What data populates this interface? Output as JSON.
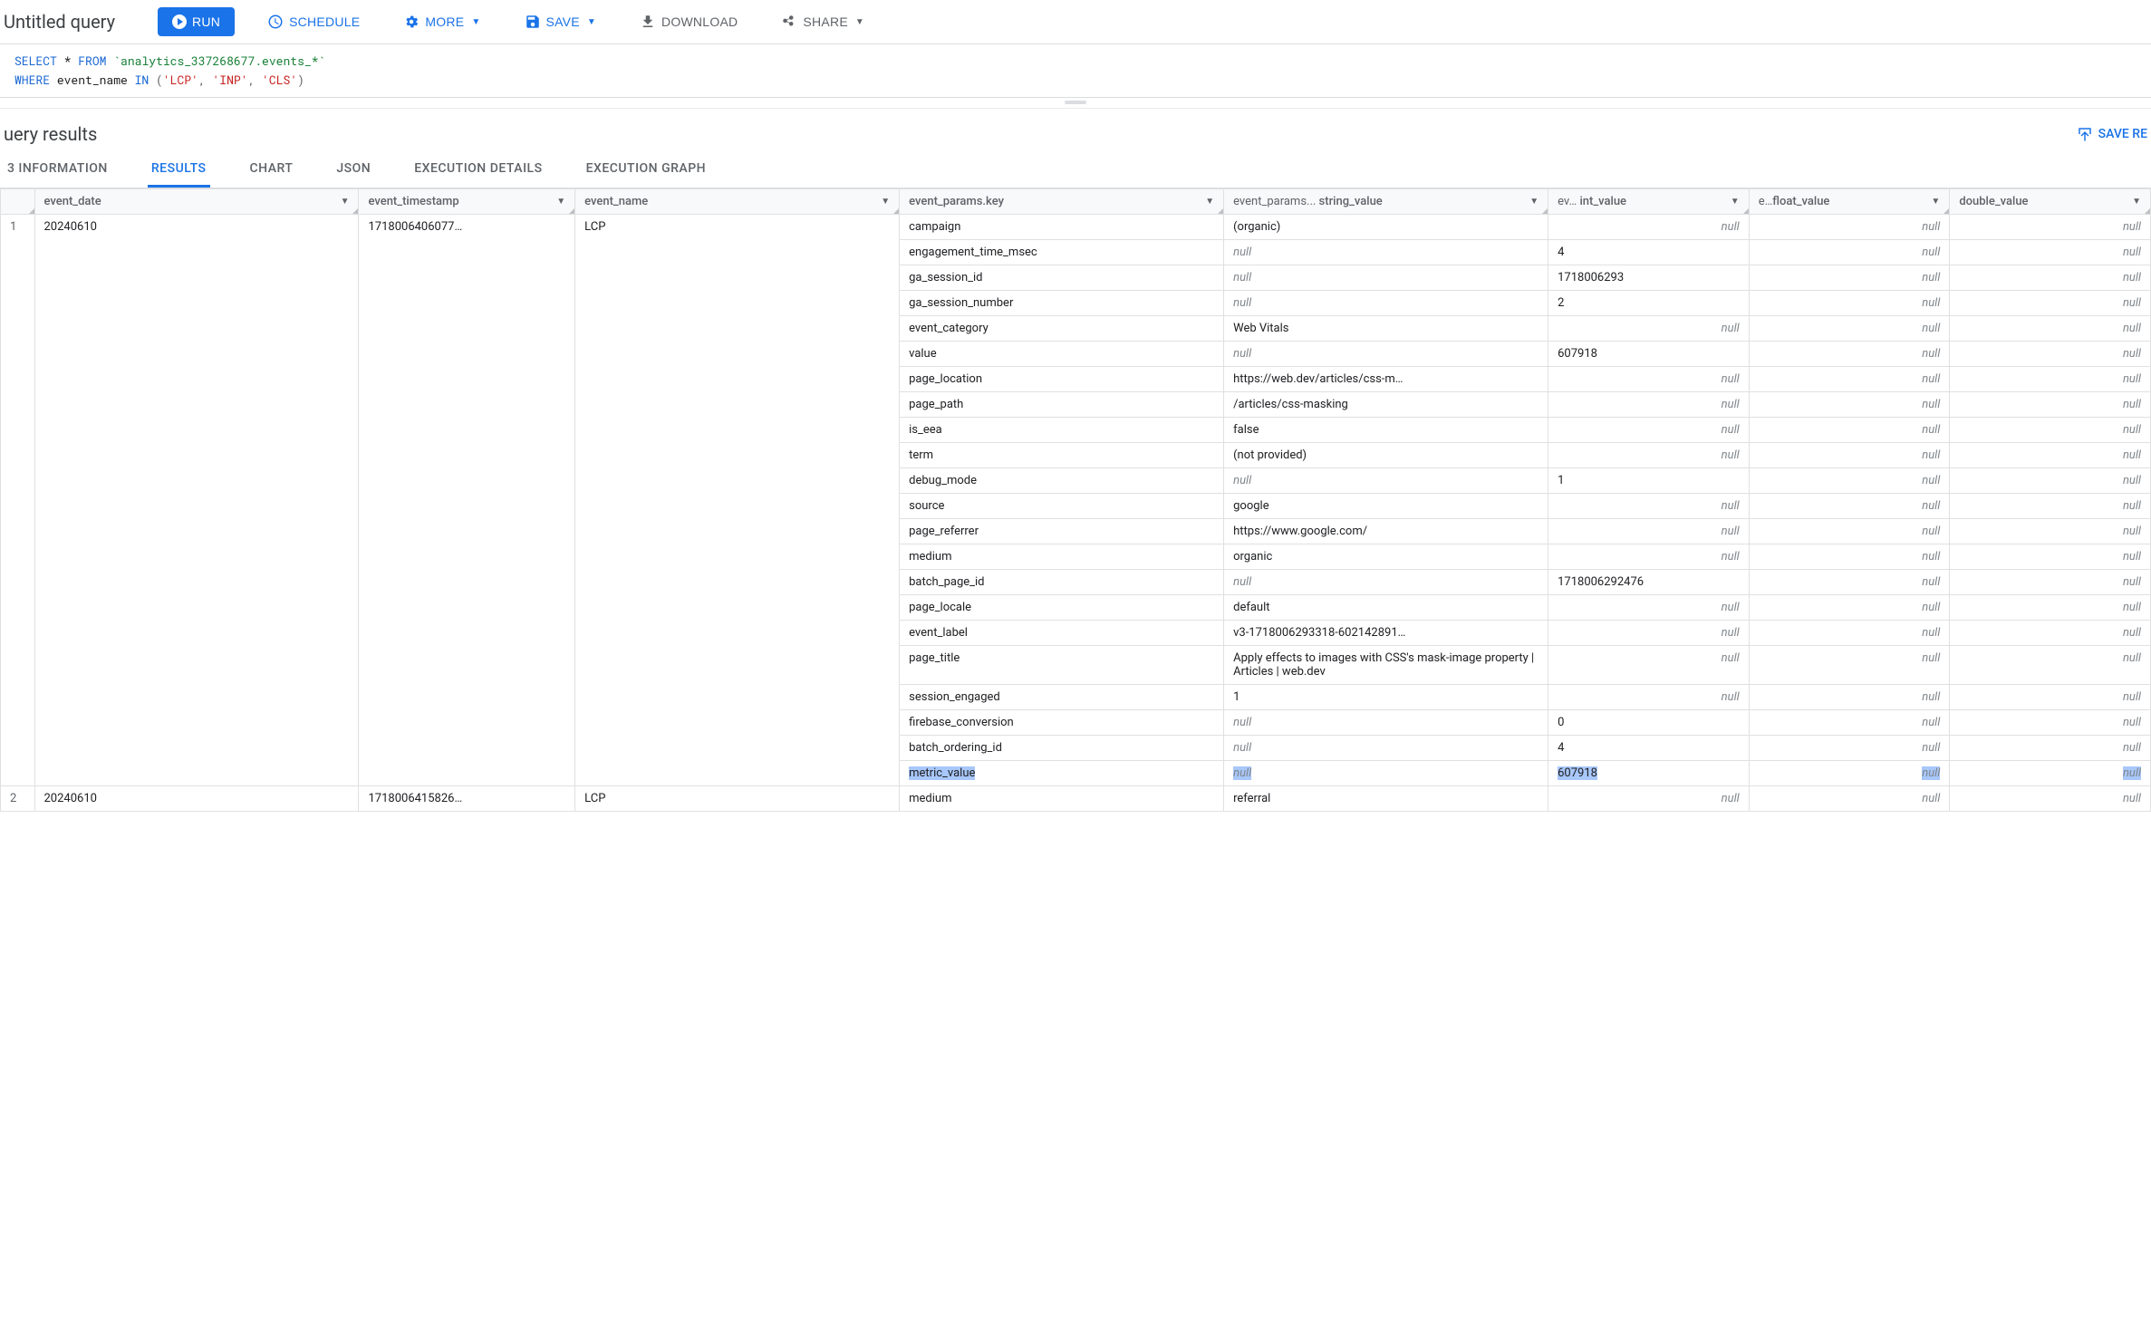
{
  "toolbar": {
    "title": "Untitled query",
    "run": "RUN",
    "schedule": "SCHEDULE",
    "more": "MORE",
    "save": "SAVE",
    "download": "DOWNLOAD",
    "share": "SHARE"
  },
  "sql": {
    "l1_kw1": "SELECT ",
    "l1_star": "*",
    "l1_kw2": " FROM ",
    "l1_tbl": "`analytics_337268677.events_*`",
    "l2_kw1": "WHERE ",
    "l2_field": "event_name",
    "l2_kw2": " IN ",
    "l2_open": "(",
    "l2_s1": "'LCP'",
    "l2_c1": ", ",
    "l2_s2": "'INP'",
    "l2_c2": ", ",
    "l2_s3": "'CLS'",
    "l2_close": ")"
  },
  "results": {
    "title": "uery results",
    "save_results": "SAVE RE"
  },
  "tabs": [
    "3 INFORMATION",
    "RESULTS",
    "CHART",
    "JSON",
    "EXECUTION DETAILS",
    "EXECUTION GRAPH"
  ],
  "headers": {
    "row": "",
    "event_date": "event_date",
    "event_timestamp": "event_timestamp",
    "event_name": "event_name",
    "key": "event_params.key",
    "string_value": "string_value",
    "string_value_prefix": "event_params...",
    "int_value": "int_value",
    "int_value_prefix": "ev…",
    "float_value": "float_value",
    "float_value_prefix": "e…",
    "double_value": "double_value"
  },
  "rows": [
    {
      "row": "1",
      "event_date": "20240610",
      "event_timestamp": "1718006406077…",
      "event_name": "LCP",
      "params": [
        {
          "key": "campaign",
          "sv": "(organic)",
          "iv": null,
          "fv": null,
          "dv": null
        },
        {
          "key": "engagement_time_msec",
          "sv": null,
          "iv": "4",
          "fv": null,
          "dv": null
        },
        {
          "key": "ga_session_id",
          "sv": null,
          "iv": "1718006293",
          "fv": null,
          "dv": null
        },
        {
          "key": "ga_session_number",
          "sv": null,
          "iv": "2",
          "fv": null,
          "dv": null
        },
        {
          "key": "event_category",
          "sv": "Web Vitals",
          "iv": null,
          "fv": null,
          "dv": null
        },
        {
          "key": "value",
          "sv": null,
          "iv": "607918",
          "fv": null,
          "dv": null
        },
        {
          "key": "page_location",
          "sv": "https://web.dev/articles/css-m…",
          "iv": null,
          "fv": null,
          "dv": null
        },
        {
          "key": "page_path",
          "sv": "/articles/css-masking",
          "iv": null,
          "fv": null,
          "dv": null
        },
        {
          "key": "is_eea",
          "sv": "false",
          "iv": null,
          "fv": null,
          "dv": null
        },
        {
          "key": "term",
          "sv": "(not provided)",
          "iv": null,
          "fv": null,
          "dv": null
        },
        {
          "key": "debug_mode",
          "sv": null,
          "iv": "1",
          "fv": null,
          "dv": null
        },
        {
          "key": "source",
          "sv": "google",
          "iv": null,
          "fv": null,
          "dv": null
        },
        {
          "key": "page_referrer",
          "sv": "https://www.google.com/",
          "iv": null,
          "fv": null,
          "dv": null
        },
        {
          "key": "medium",
          "sv": "organic",
          "iv": null,
          "fv": null,
          "dv": null
        },
        {
          "key": "batch_page_id",
          "sv": null,
          "iv": "1718006292476",
          "fv": null,
          "dv": null
        },
        {
          "key": "page_locale",
          "sv": "default",
          "iv": null,
          "fv": null,
          "dv": null
        },
        {
          "key": "event_label",
          "sv": "v3-1718006293318-602142891…",
          "iv": null,
          "fv": null,
          "dv": null
        },
        {
          "key": "page_title",
          "sv": "Apply effects to images with CSS's mask-image property  |  Articles  |  web.dev",
          "iv": null,
          "fv": null,
          "dv": null,
          "wrap": true
        },
        {
          "key": "session_engaged",
          "sv": "1",
          "iv": null,
          "fv": null,
          "dv": null
        },
        {
          "key": "firebase_conversion",
          "sv": null,
          "iv": "0",
          "fv": null,
          "dv": null
        },
        {
          "key": "batch_ordering_id",
          "sv": null,
          "iv": "4",
          "fv": null,
          "dv": null
        },
        {
          "key": "metric_value",
          "sv": null,
          "iv": "607918",
          "fv": null,
          "dv": null,
          "highlight": true
        }
      ]
    },
    {
      "row": "2",
      "event_date": "20240610",
      "event_timestamp": "1718006415826…",
      "event_name": "LCP",
      "params": [
        {
          "key": "medium",
          "sv": "referral",
          "iv": null,
          "fv": null,
          "dv": null
        }
      ]
    }
  ]
}
